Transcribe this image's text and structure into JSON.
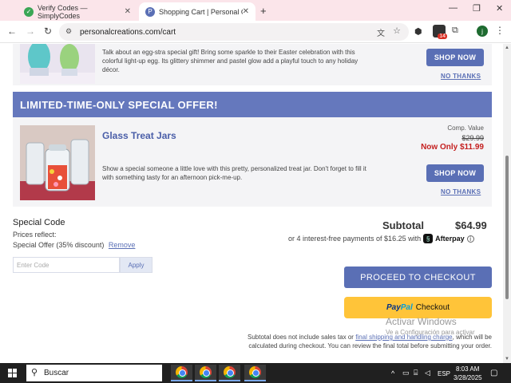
{
  "browser": {
    "tabs": [
      {
        "title": "Verify Codes — SimplyCodes",
        "active": false
      },
      {
        "title": "Shopping Cart | Personal Creatio",
        "active": true
      }
    ],
    "new_tab": "+",
    "url": "personalcreations.com/cart",
    "profile_initial": "j",
    "extension_badge": "14"
  },
  "upsell_easter": {
    "description": "Talk about an egg-stra special gift! Bring some sparkle to their Easter celebration with this colorful light-up egg. Its glittery shimmer and pastel glow add a playful touch to any holiday décor.",
    "shop_label": "SHOP NOW",
    "no_thanks_label": "NO THANKS"
  },
  "special_offer": {
    "banner": "LIMITED-TIME-ONLY SPECIAL OFFER!",
    "product_name": "Glass Treat Jars",
    "comp_label": "Comp. Value",
    "comp_value": "$29.99",
    "now_only": "Now Only $11.99",
    "description": "Show a special someone a little love with this pretty, personalized treat jar. Don't forget to fill it with something tasty for an afternoon pick-me-up.",
    "shop_label": "SHOP NOW",
    "no_thanks_label": "NO THANKS"
  },
  "special_code": {
    "title": "Special Code",
    "prices_reflect": "Prices reflect:",
    "offer_text": "Special Offer (35% discount)",
    "remove_label": "Remove",
    "input_placeholder": "Enter Code",
    "apply_label": "Apply"
  },
  "summary": {
    "subtotal_label": "Subtotal",
    "subtotal_value": "$64.99",
    "afterpay_text": "or 4 interest-free payments of $16.25 with",
    "afterpay_brand": "Afterpay",
    "checkout_label": "PROCEED TO CHECKOUT",
    "paypal_a": "Pay",
    "paypal_b": "Pal",
    "paypal_checkout": "Checkout",
    "footnote_pre": "Subtotal does not include sales tax or ",
    "footnote_link": "final shipping and handling charge",
    "footnote_post": ", which will be calculated during checkout. You can review the final total before submitting your order."
  },
  "watermark": {
    "line1": "Activar Windows",
    "line2": "Ve a Configuración para activar"
  },
  "taskbar": {
    "search_placeholder": "Buscar",
    "language": "ESP",
    "time": "8:03 AM",
    "date": "3/28/2025"
  },
  "colors": {
    "accent": "#5a6fb5",
    "banner": "#6578bd",
    "sale_red": "#c41f1f",
    "paypal_yellow": "#ffc439"
  }
}
